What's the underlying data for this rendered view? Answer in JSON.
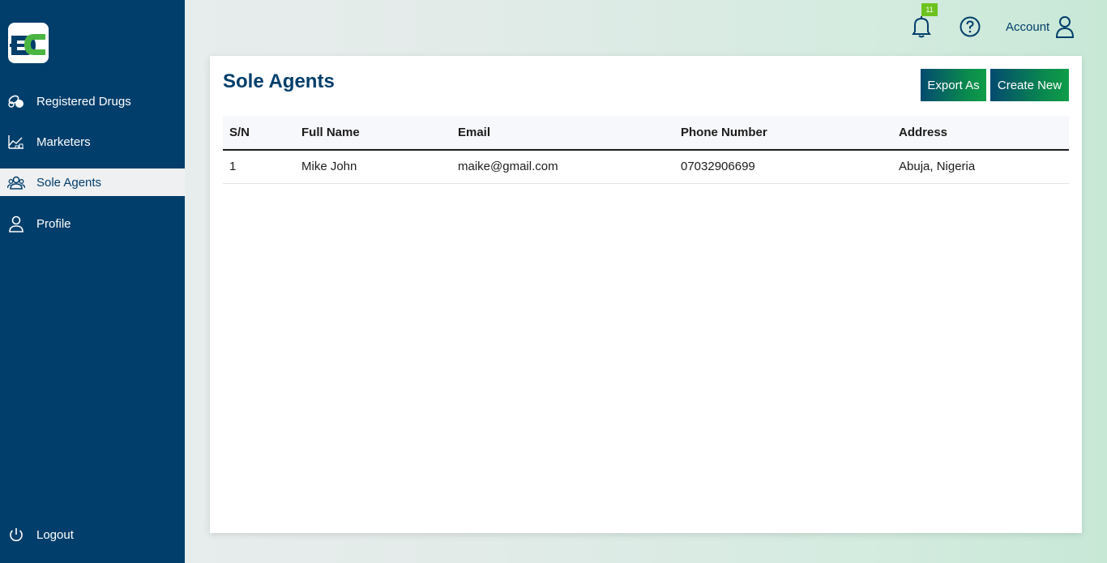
{
  "sidebar": {
    "items": [
      {
        "label": "Registered Drugs",
        "icon": "pills-icon"
      },
      {
        "label": "Marketers",
        "icon": "marketers-icon"
      },
      {
        "label": "Sole Agents",
        "icon": "users-group-icon",
        "active": true
      },
      {
        "label": "Profile",
        "icon": "user-icon"
      }
    ],
    "logout_label": "Logout"
  },
  "header": {
    "notification_count": "11",
    "account_label": "Account"
  },
  "page": {
    "title": "Sole Agents",
    "export_label": "Export As",
    "create_label": "Create New"
  },
  "table": {
    "columns": [
      "S/N",
      "Full Name",
      "Email",
      "Phone Number",
      "Address"
    ],
    "rows": [
      [
        "1",
        "Mike John",
        "maike@gmail.com",
        "07032906699",
        "Abuja, Nigeria"
      ]
    ]
  },
  "colors": {
    "sidebar": "#023e6b",
    "accent_green": "#0f9d48",
    "badge": "#6dc21f"
  }
}
